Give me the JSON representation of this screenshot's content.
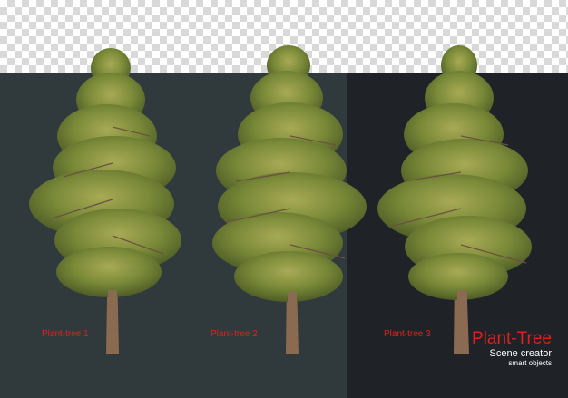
{
  "labels": {
    "tree1": "Plant-tree 1",
    "tree2": "Plant-tree 2",
    "tree3": "Plant-tree 3"
  },
  "brand": {
    "title": "Plant-Tree",
    "subtitle": "Scene creator",
    "tagline": "smart objects"
  },
  "colors": {
    "panel_left": "#303a3d",
    "panel_right": "#1f2328",
    "foliage_dark": "#55642a",
    "foliage_mid": "#7a8a38",
    "foliage_light": "#a8aa55",
    "trunk": "#8a6a50",
    "label_red": "#e0201c"
  }
}
